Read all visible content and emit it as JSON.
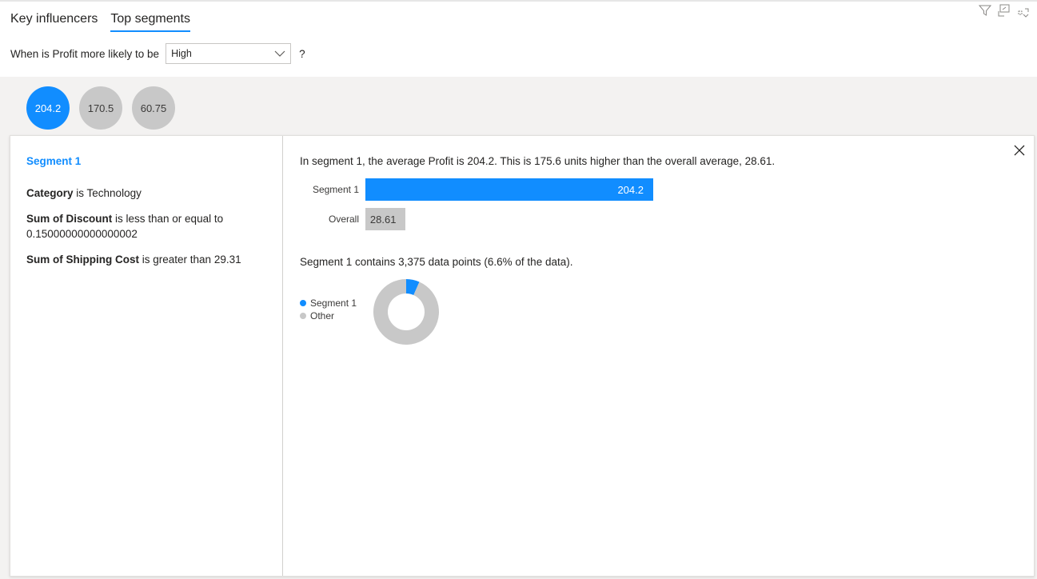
{
  "tabs": [
    {
      "label": "Key influencers",
      "active": false
    },
    {
      "label": "Top segments",
      "active": true
    }
  ],
  "question": {
    "prefix": "When is Profit more likely to be",
    "selected": "High",
    "suffix": "?"
  },
  "toolbar": {
    "icons": [
      "filter-icon",
      "focus-mode-icon",
      "more-options-icon"
    ]
  },
  "segments": [
    {
      "value": "204.2",
      "active": true
    },
    {
      "value": "170.5",
      "active": false
    },
    {
      "value": "60.75",
      "active": false
    }
  ],
  "detail": {
    "title": "Segment 1",
    "conditions": [
      {
        "field": "Category",
        "text": "is Technology"
      },
      {
        "field": "Sum of Discount",
        "text": "is less than or equal to 0.15000000000000002"
      },
      {
        "field": "Sum of Shipping Cost",
        "text": "is greater than 29.31"
      }
    ],
    "summary": "In segment 1, the average Profit is 204.2. This is 175.6 units higher than the overall average, 28.61.",
    "points_text": "Segment 1 contains 3,375 data points (6.6% of the data)."
  },
  "chart_data": [
    {
      "type": "bar",
      "categories": [
        "Segment 1",
        "Overall"
      ],
      "values": [
        204.2,
        28.61
      ],
      "value_labels": [
        "204.2",
        "28.61"
      ]
    },
    {
      "type": "pie",
      "categories": [
        "Segment 1",
        "Other"
      ],
      "values": [
        6.6,
        93.4
      ]
    }
  ],
  "colors": {
    "accent": "#118dff",
    "neutral": "#c8c8c8",
    "band": "#f3f2f1"
  }
}
